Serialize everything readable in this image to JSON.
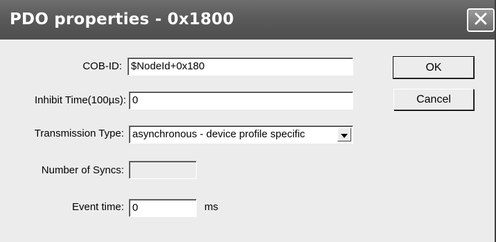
{
  "window": {
    "title": "PDO properties - 0x1800"
  },
  "form": {
    "cob_id": {
      "label": "COB-ID:",
      "value": "$NodeId+0x180"
    },
    "inhibit_time": {
      "label": "Inhibit Time(100µs):",
      "value": "0"
    },
    "transmission_type": {
      "label": "Transmission Type:",
      "selected": "asynchronous - device profile specific"
    },
    "number_of_syncs": {
      "label": "Number of Syncs:",
      "value": ""
    },
    "event_time": {
      "label": "Event time:",
      "value": "0",
      "unit": "ms"
    }
  },
  "buttons": {
    "ok": "OK",
    "cancel": "Cancel"
  },
  "icons": {
    "close": "close-icon",
    "dropdown": "chevron-down-icon"
  }
}
